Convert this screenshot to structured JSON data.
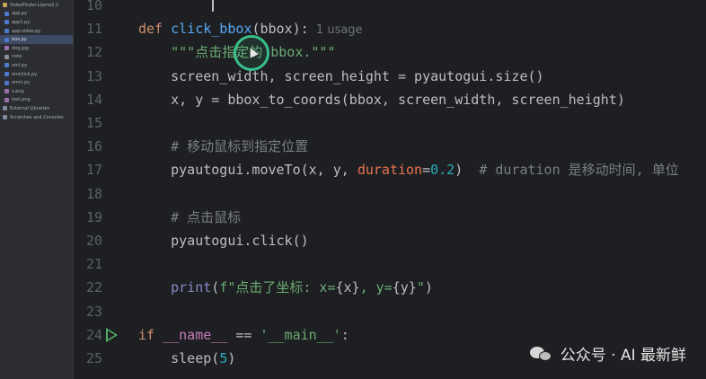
{
  "project_tree": {
    "items": [
      {
        "label": "VideoFinder-Llama3.2",
        "icon": "folder-icon",
        "kind": "folder"
      },
      {
        "label": "app.py",
        "icon": "python-file-icon",
        "kind": "py"
      },
      {
        "label": "app1.py",
        "icon": "python-file-icon",
        "kind": "py"
      },
      {
        "label": "app-video.py",
        "icon": "python-file-icon",
        "kind": "py"
      },
      {
        "label": "box.py",
        "icon": "python-file-icon",
        "kind": "py",
        "selected": true
      },
      {
        "label": "dog.jpg",
        "icon": "image-file-icon",
        "kind": "img"
      },
      {
        "label": "note",
        "icon": "text-file-icon",
        "kind": "txt"
      },
      {
        "label": "omi.py",
        "icon": "python-file-icon",
        "kind": "py"
      },
      {
        "label": "omiclick.py",
        "icon": "python-file-icon",
        "kind": "py"
      },
      {
        "label": "omni.py",
        "icon": "python-file-icon",
        "kind": "py"
      },
      {
        "label": "s.png",
        "icon": "image-file-icon",
        "kind": "img"
      },
      {
        "label": "test.png",
        "icon": "image-file-icon",
        "kind": "img"
      },
      {
        "label": "External Libraries",
        "icon": "library-icon",
        "kind": "lib"
      },
      {
        "label": "Scratches and Consoles",
        "icon": "scratch-icon",
        "kind": "lib"
      }
    ]
  },
  "editor": {
    "lines": [
      {
        "num": "10",
        "tokens": []
      },
      {
        "num": "11",
        "tokens": [
          {
            "t": "def ",
            "c": "kw"
          },
          {
            "t": "click_bbox",
            "c": "fn"
          },
          {
            "t": "(bbox):",
            "c": "plain"
          },
          {
            "t": "  1 usage",
            "c": "hint"
          }
        ]
      },
      {
        "num": "12",
        "tokens": [
          {
            "t": "    \"\"\"点击指定的 bbox.\"\"\"",
            "c": "str"
          }
        ]
      },
      {
        "num": "13",
        "tokens": [
          {
            "t": "    screen_width, screen_height = pyautogui.size()",
            "c": "plain"
          }
        ]
      },
      {
        "num": "14",
        "tokens": [
          {
            "t": "    x, y = bbox_to_coords(bbox, screen_width, screen_height)",
            "c": "plain"
          }
        ]
      },
      {
        "num": "15",
        "tokens": []
      },
      {
        "num": "16",
        "tokens": [
          {
            "t": "    # 移动鼠标到指定位置",
            "c": "cmt"
          }
        ]
      },
      {
        "num": "17",
        "tokens": [
          {
            "t": "    pyautogui.moveTo(x, y, ",
            "c": "plain"
          },
          {
            "t": "duration",
            "c": "param"
          },
          {
            "t": "=",
            "c": "plain"
          },
          {
            "t": "0.2",
            "c": "num"
          },
          {
            "t": ")  ",
            "c": "plain"
          },
          {
            "t": "# duration 是移动时间, 单位",
            "c": "cmt"
          }
        ]
      },
      {
        "num": "18",
        "tokens": []
      },
      {
        "num": "19",
        "tokens": [
          {
            "t": "    # 点击鼠标",
            "c": "cmt"
          }
        ]
      },
      {
        "num": "20",
        "tokens": [
          {
            "t": "    pyautogui.click()",
            "c": "plain"
          }
        ]
      },
      {
        "num": "21",
        "tokens": []
      },
      {
        "num": "22",
        "tokens": [
          {
            "t": "    ",
            "c": "plain"
          },
          {
            "t": "print",
            "c": "builtin"
          },
          {
            "t": "(",
            "c": "plain"
          },
          {
            "t": "f\"点击了坐标: x=",
            "c": "str"
          },
          {
            "t": "{x}",
            "c": "plain"
          },
          {
            "t": ", y=",
            "c": "str"
          },
          {
            "t": "{y}",
            "c": "plain"
          },
          {
            "t": "\"",
            "c": "str"
          },
          {
            "t": ")",
            "c": "plain"
          }
        ]
      },
      {
        "num": "23",
        "tokens": []
      },
      {
        "num": "24",
        "run": true,
        "tokens": [
          {
            "t": "if ",
            "c": "kw"
          },
          {
            "t": "__name__",
            "c": "dunder2"
          },
          {
            "t": " == ",
            "c": "plain"
          },
          {
            "t": "'__main__'",
            "c": "str"
          },
          {
            "t": ":",
            "c": "plain"
          }
        ]
      },
      {
        "num": "25",
        "tokens": [
          {
            "t": "    sleep(",
            "c": "plain"
          },
          {
            "t": "5",
            "c": "num"
          },
          {
            "t": ")",
            "c": "plain"
          }
        ]
      }
    ]
  },
  "watermark": {
    "logo_icon": "wechat-icon",
    "text": "公众号 · AI 最新鲜"
  },
  "colors": {
    "background": "#1e1f22",
    "sidebar": "#2b2d30",
    "click_ring": "#38c08a"
  }
}
